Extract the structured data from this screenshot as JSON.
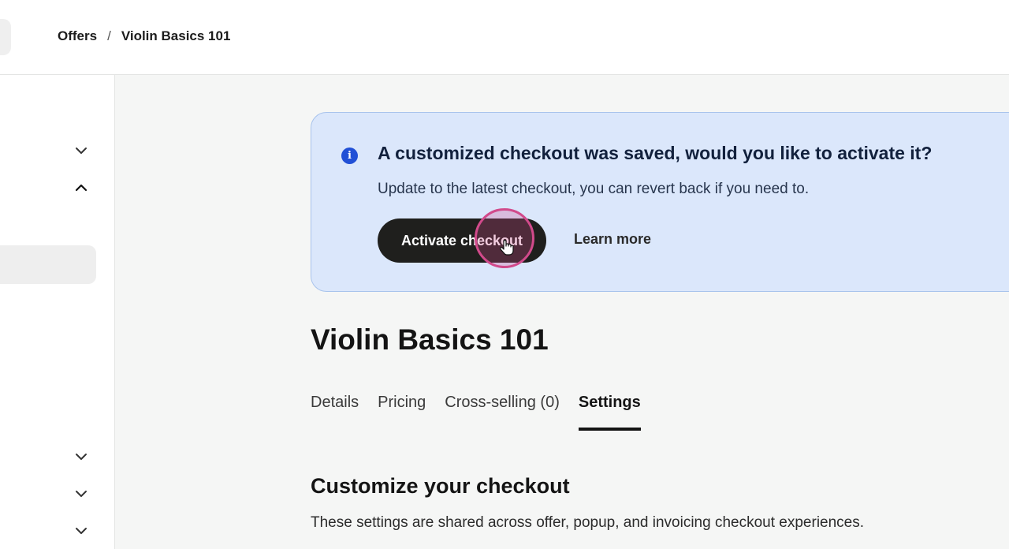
{
  "breadcrumb": {
    "parent": "Offers",
    "separator": "/",
    "current": "Violin Basics 101"
  },
  "sidebar": {
    "chevrons": [
      "chevron-down-icon",
      "chevron-up-icon",
      "chevron-down-icon",
      "chevron-down-icon",
      "chevron-down-icon"
    ]
  },
  "banner": {
    "icon": "info-icon",
    "title": "A customized checkout was saved, would you like to activate it?",
    "text": "Update to the latest checkout, you can revert back if you need to.",
    "primary_button": "Activate checkout",
    "secondary_link": "Learn more",
    "colors": {
      "background": "#dbe7fb",
      "border": "#a8c3ec",
      "icon": "#2150d6"
    }
  },
  "page": {
    "title": "Violin Basics 101",
    "tabs": [
      {
        "label": "Details",
        "active": false
      },
      {
        "label": "Pricing",
        "active": false
      },
      {
        "label": "Cross-selling (0)",
        "active": false
      },
      {
        "label": "Settings",
        "active": true
      }
    ]
  },
  "section": {
    "title": "Customize your checkout",
    "description": "These settings are shared across offer, popup, and invoicing checkout experiences."
  }
}
